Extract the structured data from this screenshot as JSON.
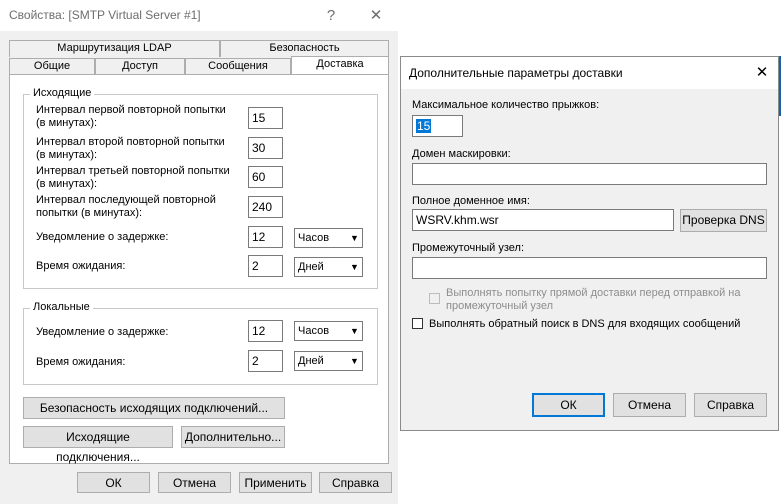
{
  "left_window": {
    "title": "Свойства: [SMTP Virtual Server #1]",
    "help_glyph": "?",
    "close_glyph": "✕",
    "tabs_row1": [
      "Маршрутизация LDAP",
      "Безопасность"
    ],
    "tabs_row2": [
      "Общие",
      "Доступ",
      "Сообщения",
      "Доставка"
    ],
    "active_tab": "Доставка",
    "outgoing": {
      "legend": "Исходящие",
      "first_retry_label": "Интервал первой повторной попытки\n(в минутах):",
      "first_retry_value": "15",
      "second_retry_label": "Интервал второй повторной попытки\n(в минутах):",
      "second_retry_value": "30",
      "third_retry_label": "Интервал третьей повторной попытки\n(в минутах):",
      "third_retry_value": "60",
      "subsequent_retry_label": "Интервал последующей повторной\nпопытки (в минутах):",
      "subsequent_retry_value": "240",
      "delay_notification_label": "Уведомление о задержке:",
      "delay_notification_value": "12",
      "delay_notification_unit": "Часов",
      "expiration_label": "Время ожидания:",
      "expiration_value": "2",
      "expiration_unit": "Дней"
    },
    "local": {
      "legend": "Локальные",
      "delay_notification_label": "Уведомление о задержке:",
      "delay_notification_value": "12",
      "delay_notification_unit": "Часов",
      "expiration_label": "Время ожидания:",
      "expiration_value": "2",
      "expiration_unit": "Дней"
    },
    "buttons": {
      "outbound_security": "Безопасность исходящих подключений...",
      "outbound_connections": "Исходящие подключения...",
      "advanced": "Дополнительно...",
      "ok": "ОК",
      "cancel": "Отмена",
      "apply": "Применить",
      "help": "Справка"
    }
  },
  "right_window": {
    "title": "Дополнительные параметры доставки",
    "close_glyph": "✕",
    "max_hop_label": "Максимальное количество прыжков:",
    "max_hop_value": "15",
    "masquerade_label": "Домен маскировки:",
    "masquerade_value": "",
    "fqdn_label": "Полное доменное имя:",
    "fqdn_value": "WSRV.khm.wsr",
    "check_dns_button": "Проверка DNS",
    "smart_host_label": "Промежуточный узел:",
    "smart_host_value": "",
    "attempt_direct_label": "Выполнять попытку прямой доставки перед отправкой на\nпромежуточный узел",
    "reverse_dns_label": "Выполнять обратный поиск в DNS для входящих сообщений",
    "buttons": {
      "ok": "ОК",
      "cancel": "Отмена",
      "help": "Справка"
    }
  },
  "colors": {
    "accent": "#0078d7",
    "dialog_bg": "#f0f0f0",
    "button_bg": "#e1e1e1"
  }
}
